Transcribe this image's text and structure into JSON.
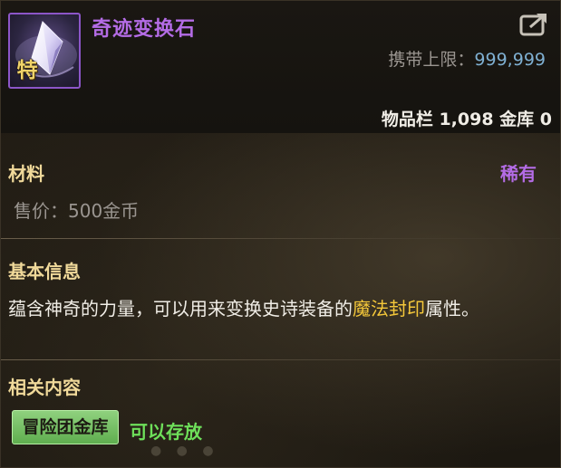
{
  "item": {
    "name": "奇迹变换石",
    "badge": "特",
    "carry_limit_label": "携带上限：",
    "carry_limit_value": "999,999",
    "storage_text": "物品栏 1,098 金库 0"
  },
  "category": {
    "type": "材料",
    "rarity": "稀有",
    "price": "售价：500金币"
  },
  "basic_info": {
    "title": "基本信息",
    "desc_before": "蕴含神奇的力量，可以用来变换史诗装备的",
    "desc_highlight": "魔法封印",
    "desc_after": "属性。"
  },
  "related": {
    "title": "相关内容",
    "tag_label": "冒险团金库",
    "status": "可以存放"
  },
  "icons": {
    "share": "share-export-icon",
    "item": "crystal-icon"
  },
  "colors": {
    "title_purple": "#b46ce6",
    "highlight_yellow": "#f5c83a",
    "status_green": "#6ee05a",
    "section_gold": "#f0d99a"
  }
}
